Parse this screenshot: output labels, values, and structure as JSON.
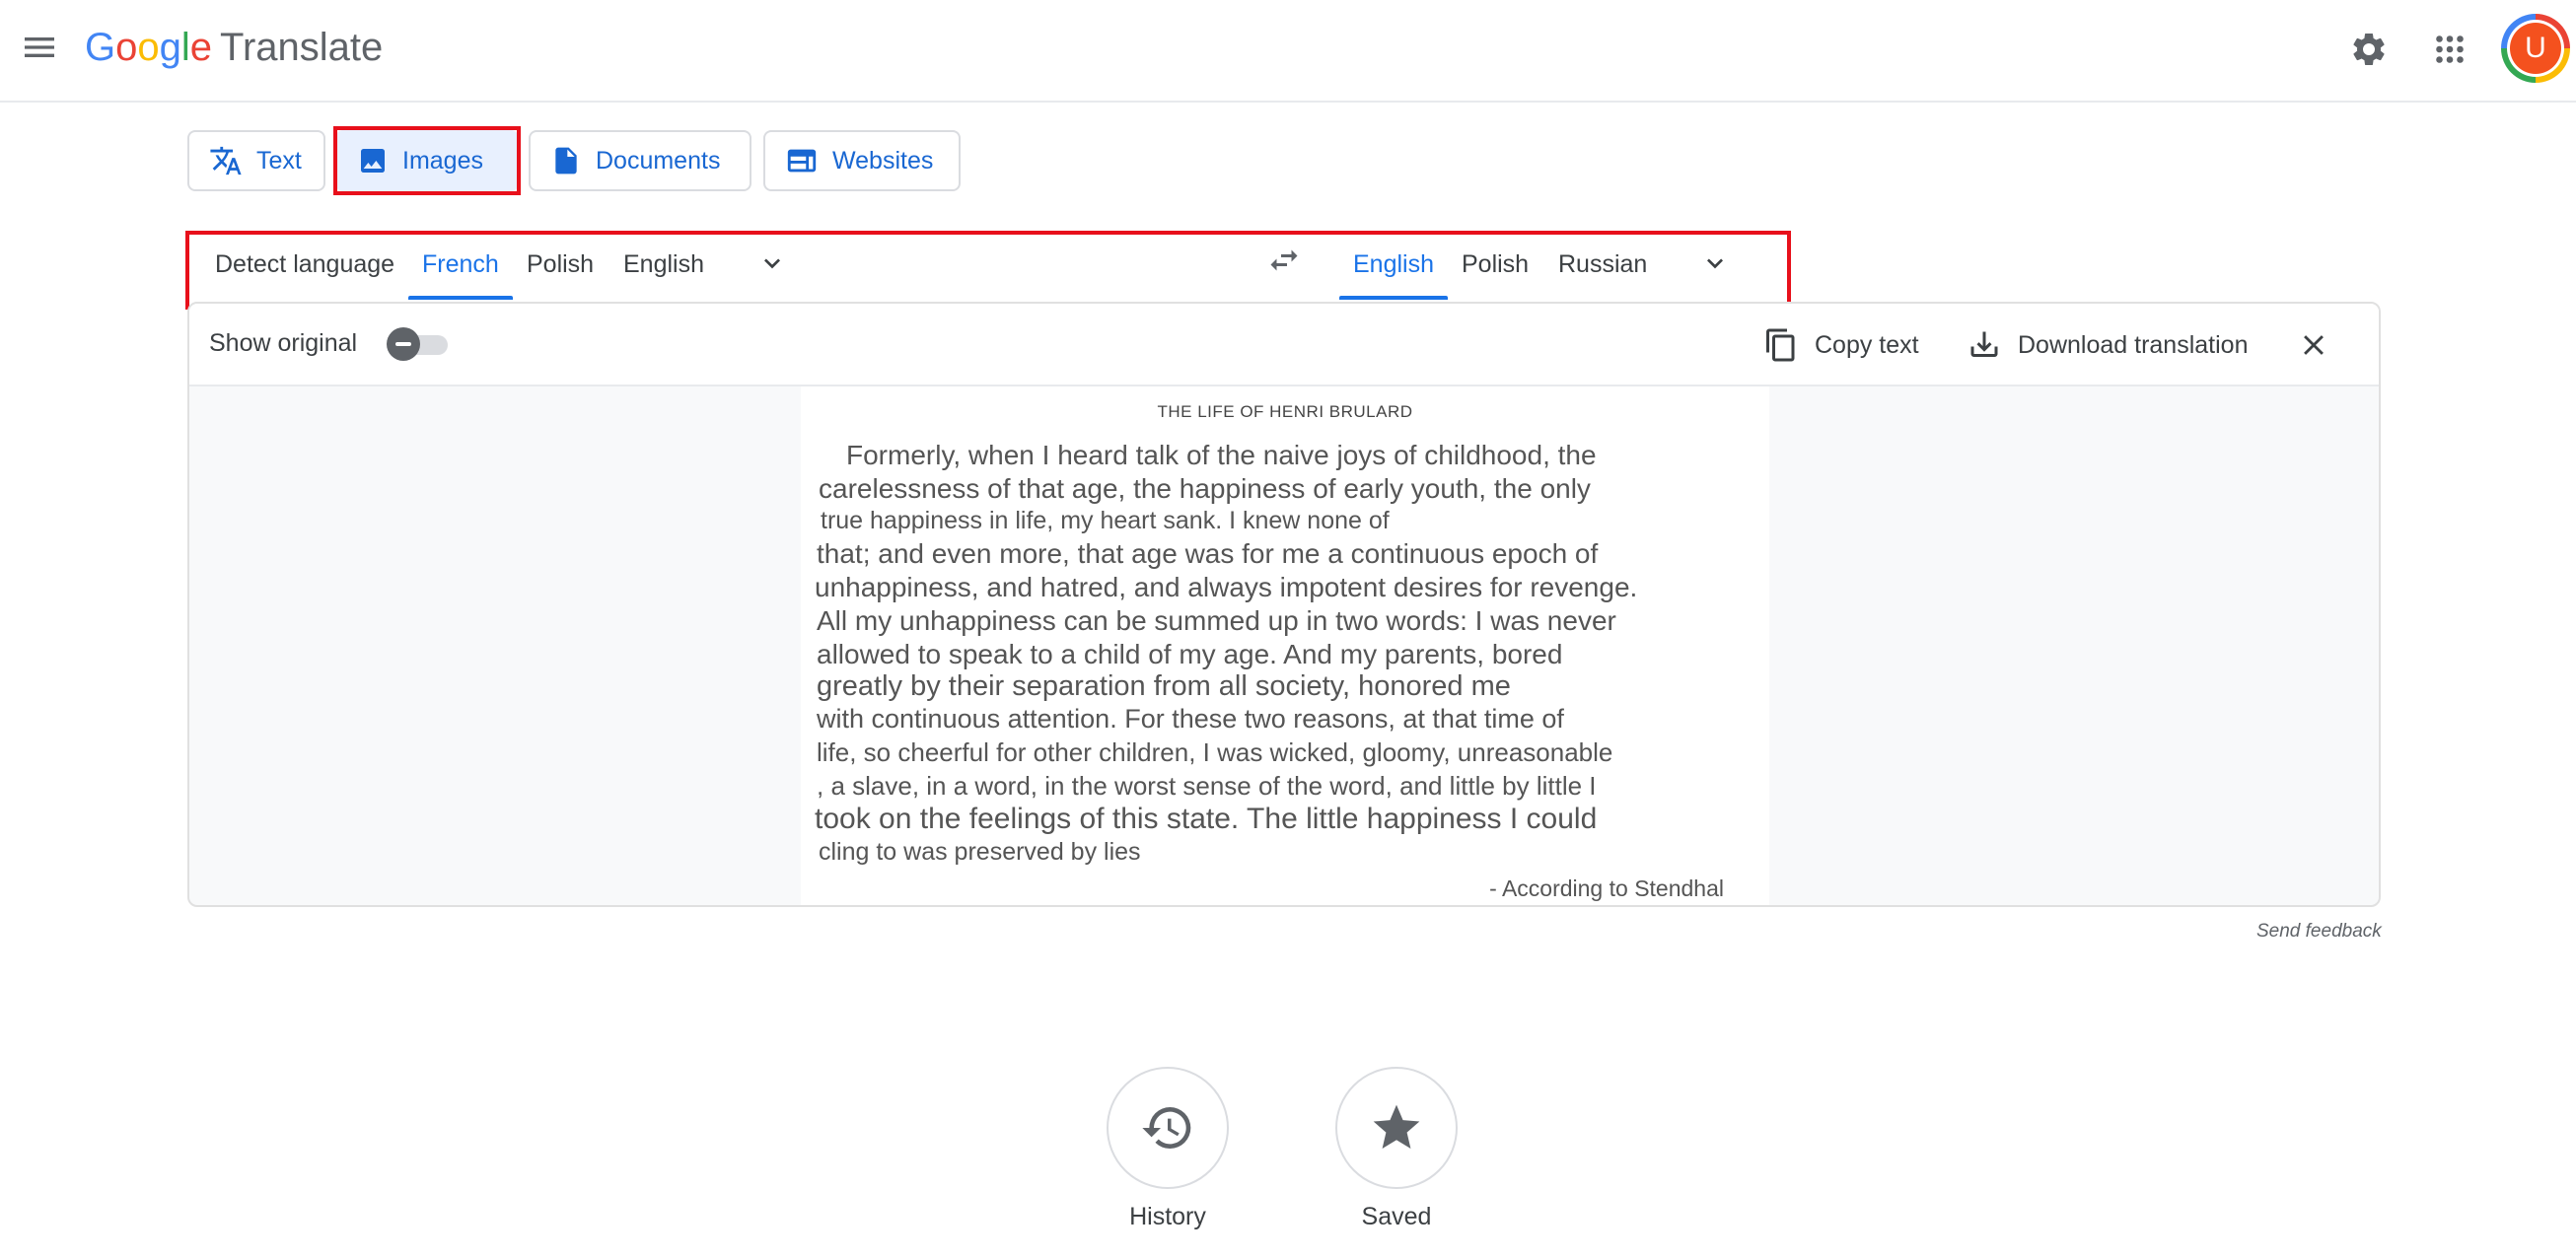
{
  "header": {
    "logo_letters": [
      "G",
      "o",
      "o",
      "g",
      "l",
      "e"
    ],
    "product": "Translate",
    "avatar_initial": "U",
    "avatar_color": "#f4511e"
  },
  "modes": [
    {
      "label": "Text",
      "icon": "translate-icon",
      "active": false
    },
    {
      "label": "Images",
      "icon": "image-icon",
      "active": true
    },
    {
      "label": "Documents",
      "icon": "document-icon",
      "active": false
    },
    {
      "label": "Websites",
      "icon": "website-icon",
      "active": false
    }
  ],
  "source_languages": {
    "items": [
      "Detect language",
      "French",
      "Polish",
      "English"
    ],
    "selected": "French"
  },
  "target_languages": {
    "items": [
      "English",
      "Polish",
      "Russian"
    ],
    "selected": "English"
  },
  "toolbar": {
    "show_original": "Show original",
    "show_original_on": false,
    "copy_text": "Copy text",
    "download": "Download translation"
  },
  "document": {
    "title": "THE LIFE OF HENRI BRULARD",
    "lines": [
      "Formerly, when I heard talk of the naive joys of childhood, the",
      "carelessness of that age, the happiness of early youth, the only",
      "true happiness in life, my heart sank. I knew none of",
      "that; and even more, that age was for me a continuous epoch of",
      "unhappiness, and hatred, and always impotent desires for revenge.",
      "All my unhappiness can be summed up in two words: I was never",
      "allowed to speak to a child of my age. And my parents, bored",
      "greatly by their separation from all society, honored me",
      "with continuous attention. For these two reasons, at that time of",
      "life, so cheerful for other children, I was wicked, gloomy, unreasonable",
      ", a slave, in a word, in the worst sense of the word, and little by little I",
      "took on the feelings of this state. The little happiness I could",
      "cling to was preserved by lies"
    ],
    "signature": "- According to Stendhal"
  },
  "feedback": "Send feedback",
  "bottom": {
    "history": "History",
    "saved": "Saved"
  },
  "colors": {
    "accent": "#1a73e8",
    "highlight_box": "#e8101b",
    "active_tab_bg": "#e8f0fe"
  }
}
